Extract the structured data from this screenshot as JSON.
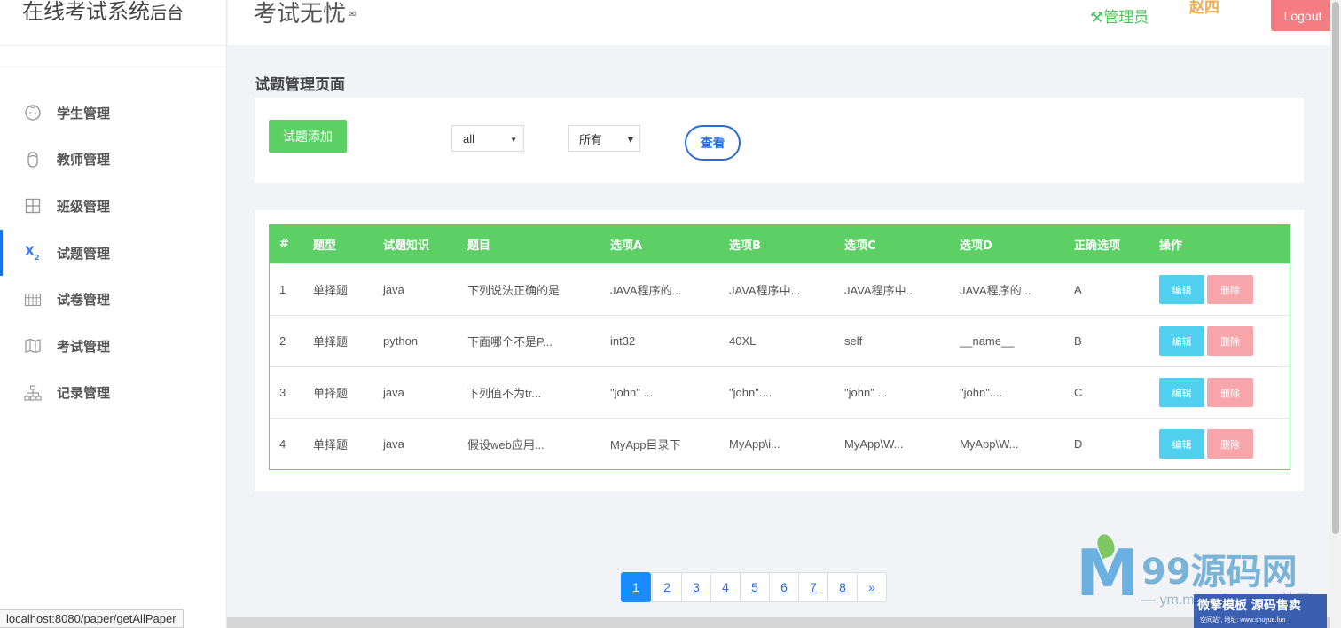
{
  "brand": {
    "title": "在线考试系统",
    "suffix": "后台"
  },
  "header": {
    "app_title": "考试无忧",
    "role": "管理员",
    "user": "赵四",
    "logout": "Logout"
  },
  "sidebar": {
    "items": [
      {
        "label": "学生管理",
        "icon": "student-icon",
        "active": false
      },
      {
        "label": "教师管理",
        "icon": "teacher-icon",
        "active": false
      },
      {
        "label": "班级管理",
        "icon": "grid-icon",
        "active": false
      },
      {
        "label": "试题管理",
        "icon": "subscript-x-icon",
        "active": true
      },
      {
        "label": "试卷管理",
        "icon": "table-icon",
        "active": false
      },
      {
        "label": "考试管理",
        "icon": "map-icon",
        "active": false
      },
      {
        "label": "记录管理",
        "icon": "sitemap-icon",
        "active": false
      }
    ]
  },
  "main": {
    "heading": "试题管理页面",
    "add_button": "试题添加",
    "filter_knowledge": "all",
    "filter_type": "所有",
    "view_button": "查看"
  },
  "table": {
    "headers": [
      "#",
      "题型",
      "试题知识",
      "题目",
      "选项A",
      "选项B",
      "选项C",
      "选项D",
      "正确选项",
      "操作"
    ],
    "rows": [
      [
        "1",
        "单择题",
        "java",
        "下列说法正确的是",
        "JAVA程序的...",
        "JAVA程序中...",
        "JAVA程序中...",
        "JAVA程序的...",
        "A"
      ],
      [
        "2",
        "单择题",
        "python",
        "下面哪个不是P...",
        "int32",
        "40XL",
        "self",
        "__name__",
        "B"
      ],
      [
        "3",
        "单择题",
        "java",
        "下列值不为tr...",
        "\"john\" ...",
        "\"john\"....",
        "\"john\" ...",
        "\"john\"....",
        "C"
      ],
      [
        "4",
        "单择题",
        "java",
        "假设web应用...",
        "MyApp目录下",
        "MyApp\\i...",
        "MyApp\\W...",
        "MyApp\\W...",
        "D"
      ]
    ],
    "edit_label": "编辑",
    "delete_label": "删除"
  },
  "pagination": {
    "pages": [
      "1",
      "2",
      "3",
      "4",
      "5",
      "6",
      "7",
      "8"
    ],
    "next": "»",
    "current": "1"
  },
  "statusbar": {
    "url": "localhost:8080/paper/getAllPaper"
  },
  "watermark": {
    "logo": "M",
    "text": "99源码网",
    "sub": "— ym.maptofree.com 社区",
    "box_title": "微擎模板 源码售卖",
    "box_text": "空间站\", 地址: www.shuyue.fun"
  },
  "colors": {
    "primary_green": "#5cd065",
    "accent_blue": "#2b6bd6",
    "edit": "#4fd0ee",
    "delete": "#f8a6ab",
    "logout": "#f47d83"
  }
}
